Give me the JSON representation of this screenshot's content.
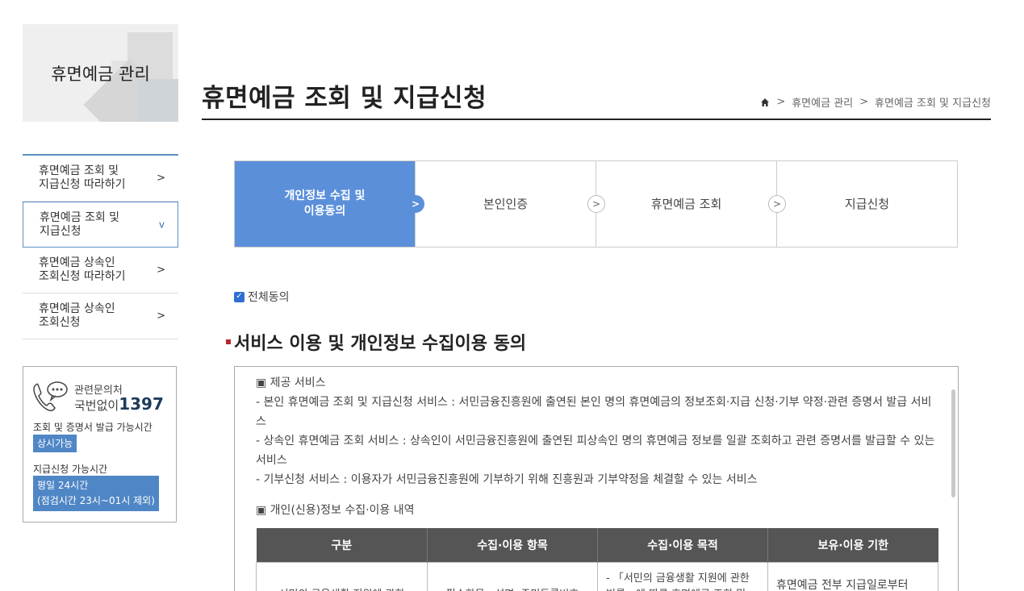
{
  "sidebar": {
    "banner_title": "휴면예금 관리",
    "items": [
      {
        "label": "휴면예금 조회 및\n지급신청 따라하기",
        "arrow": ">"
      },
      {
        "label": "휴면예금 조회 및\n지급신청",
        "arrow": "v"
      },
      {
        "label": "휴면예금 상속인\n조회신청 따라하기",
        "arrow": ">"
      },
      {
        "label": "휴면예금 상속인\n조회신청",
        "arrow": ">"
      }
    ],
    "contact": {
      "line1": "관련문의처",
      "line2_prefix": "국번없이",
      "phone": "1397",
      "label1": "조회 및 증명서 발급 가능시간",
      "badge1": "상시가능",
      "label2": "지급신청 가능시간",
      "badge2_line1": "평일 24시간",
      "badge2_line2": "(점검시간 23시~01시 제외)"
    }
  },
  "header": {
    "title": "휴면예금 조회 및 지급신청",
    "breadcrumb": [
      ">",
      "휴면예금 관리",
      ">",
      "휴면예금 조회 및 지급신청"
    ]
  },
  "steps": [
    {
      "label": "개인정보 수집 및\n이용동의",
      "active": true
    },
    {
      "label": "본인인증",
      "active": false
    },
    {
      "label": "휴면예금 조회",
      "active": false
    },
    {
      "label": "지급신청",
      "active": false
    }
  ],
  "agree_all_label": "전체동의",
  "section_title": "서비스 이용 및 개인정보 수집이용 동의",
  "terms": {
    "heading1": "▣ 제공 서비스",
    "lines": [
      "- 본인 휴면예금 조회 및 지급신청 서비스 : 서민금융진흥원에 출연된 본인 명의 휴면예금의 정보조회·지급 신청·기부 약정·관련 증명서 발급 서비스",
      "- 상속인 휴면예금 조회 서비스 : 상속인이 서민금융진흥원에 출연된 피상속인 명의 휴면예금 정보를 일괄 조회하고 관련 증명서를 발급할 수 있는 서비스",
      "- 기부신청 서비스 : 이용자가 서민금융진흥원에 기부하기 위해 진흥원과 기부약정을 체결할 수 있는 서비스"
    ],
    "heading2": "▣ 개인(신용)정보 수집·이용 내역",
    "table_headers": [
      "구분",
      "수집·이용 항목",
      "수집·이용 목적",
      "보유·이용 기한"
    ],
    "table_row": [
      "서민의 금융생활 지원에 관한",
      "필수항목 : 성명, 주민등록번호",
      "- 「서민의 금융생활 지원에 관한 법률」에 따른 휴면예금 조회 및",
      "휴면예금 전부 지급일로부터"
    ]
  }
}
